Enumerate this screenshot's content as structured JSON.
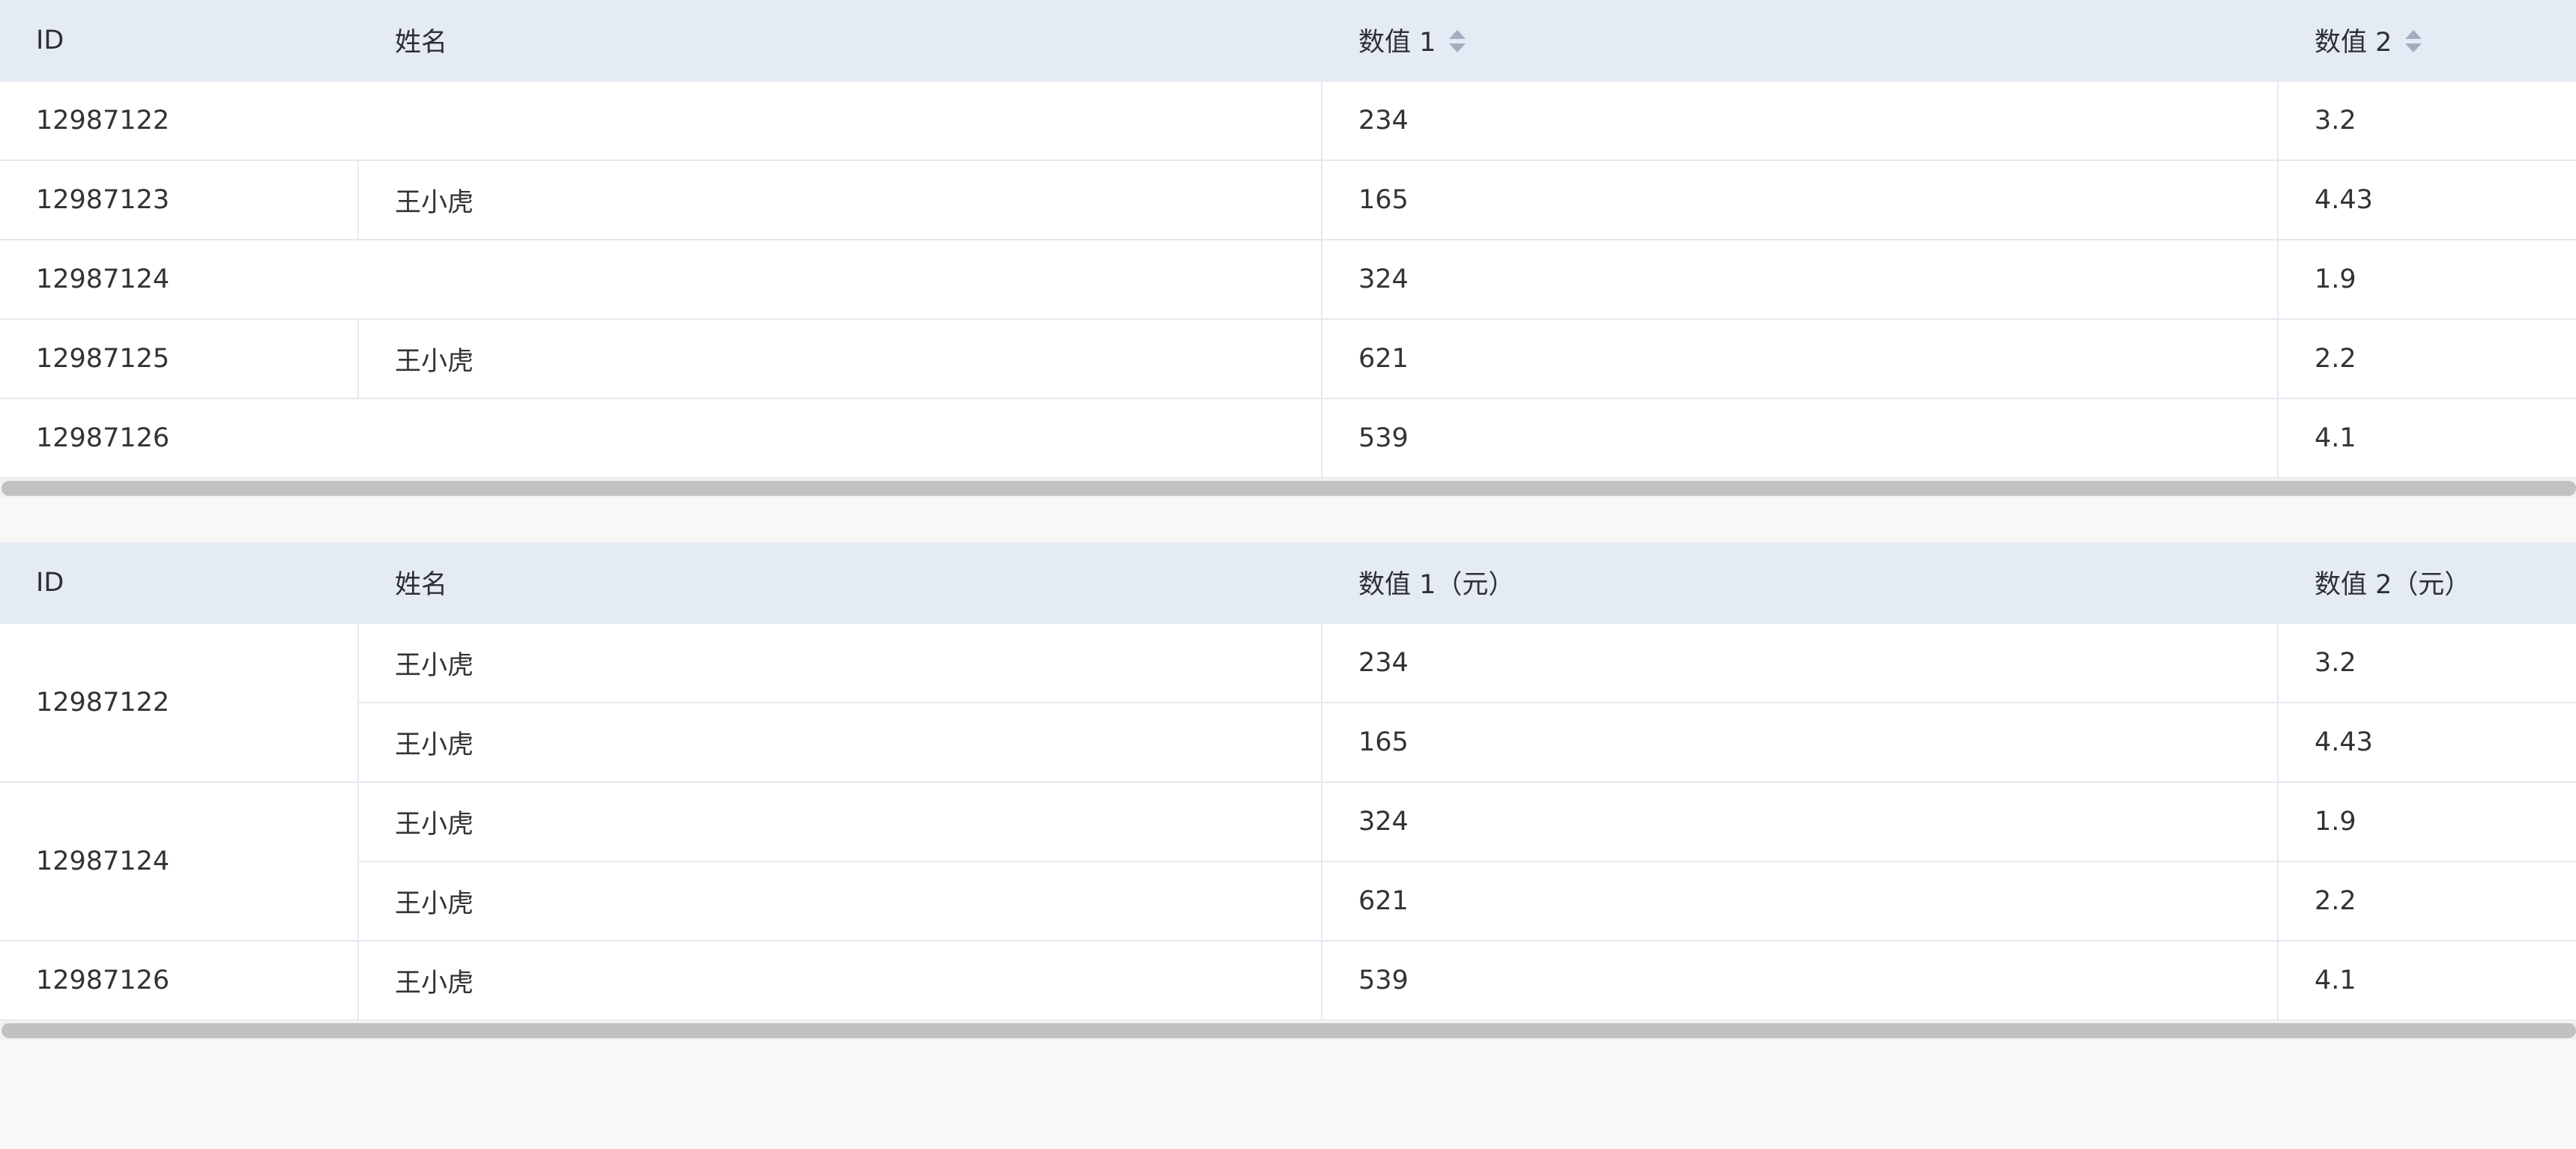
{
  "table1": {
    "headers": {
      "id": "ID",
      "name": "姓名",
      "value1": "数值 1",
      "value2": "数值 2"
    },
    "rows": [
      {
        "id": "12987122",
        "name": "",
        "value1": "234",
        "value2": "3.2"
      },
      {
        "id": "12987123",
        "name": "王小虎",
        "value1": "165",
        "value2": "4.43"
      },
      {
        "id": "12987124",
        "name": "",
        "value1": "324",
        "value2": "1.9"
      },
      {
        "id": "12987125",
        "name": "王小虎",
        "value1": "621",
        "value2": "2.2"
      },
      {
        "id": "12987126",
        "name": "",
        "value1": "539",
        "value2": "4.1"
      }
    ]
  },
  "table2": {
    "headers": {
      "id": "ID",
      "name": "姓名",
      "value1": "数值 1（元）",
      "value2": "数值 2（元）"
    },
    "rows": [
      {
        "id": "12987122",
        "name": "王小虎",
        "value1": "234",
        "value2": "3.2"
      },
      {
        "id": "",
        "name": "王小虎",
        "value1": "165",
        "value2": "4.43"
      },
      {
        "id": "12987124",
        "name": "王小虎",
        "value1": "324",
        "value2": "1.9"
      },
      {
        "id": "",
        "name": "王小虎",
        "value1": "621",
        "value2": "2.2"
      },
      {
        "id": "12987126",
        "name": "王小虎",
        "value1": "539",
        "value2": "4.1"
      }
    ]
  },
  "colors": {
    "header_bg": "#e5ebf4",
    "border": "#e3e9f0",
    "scrollbar_thumb": "#c1c1c1",
    "page_bg": "#f8f8f8"
  },
  "icons": [
    "sort-icon"
  ]
}
